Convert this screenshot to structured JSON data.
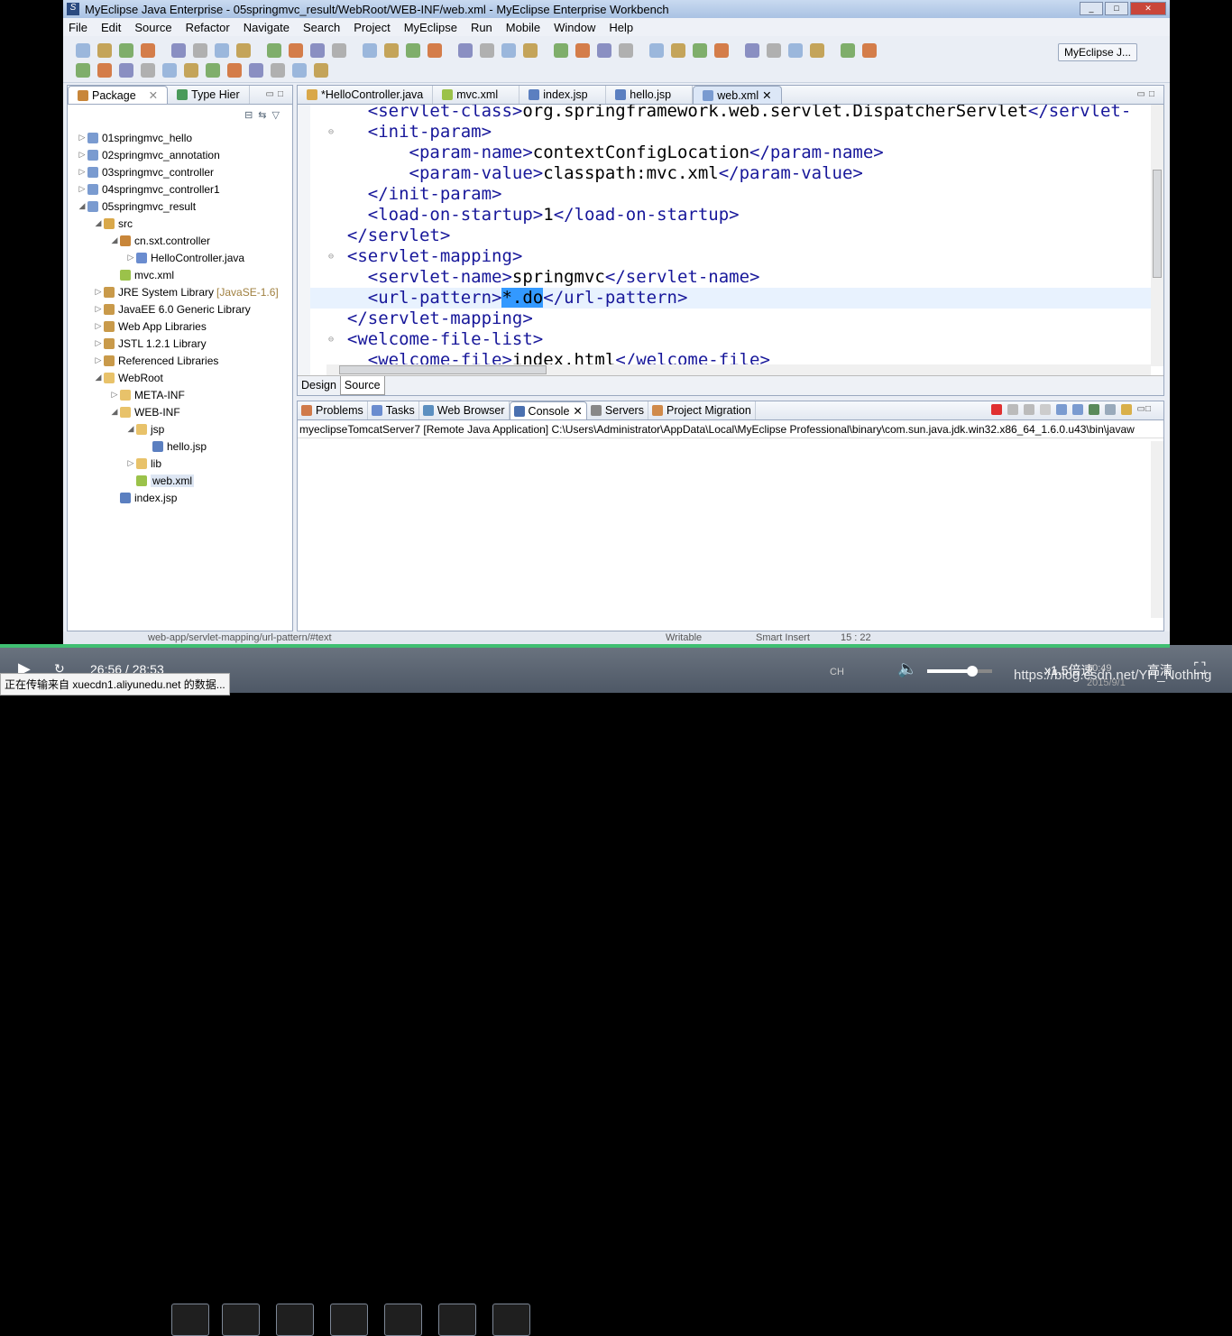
{
  "window": {
    "title": "MyEclipse Java Enterprise - 05springmvc_result/WebRoot/WEB-INF/web.xml - MyEclipse Enterprise Workbench"
  },
  "menu": [
    "File",
    "Edit",
    "Source",
    "Refactor",
    "Navigate",
    "Search",
    "Project",
    "MyEclipse",
    "Run",
    "Mobile",
    "Window",
    "Help"
  ],
  "perspective": "MyEclipse J...",
  "left_panel": {
    "tabs": [
      "Package",
      "Type Hier"
    ],
    "tree": [
      {
        "label": "01springmvc_hello",
        "level": 0,
        "arrow": "▷",
        "icon": "project"
      },
      {
        "label": "02springmvc_annotation",
        "level": 0,
        "arrow": "▷",
        "icon": "project"
      },
      {
        "label": "03springmvc_controller",
        "level": 0,
        "arrow": "▷",
        "icon": "project"
      },
      {
        "label": "04springmvc_controller1",
        "level": 0,
        "arrow": "▷",
        "icon": "project"
      },
      {
        "label": "05springmvc_result",
        "level": 0,
        "arrow": "◢",
        "icon": "project"
      },
      {
        "label": "src",
        "level": 1,
        "arrow": "◢",
        "icon": "src"
      },
      {
        "label": "cn.sxt.controller",
        "level": 2,
        "arrow": "◢",
        "icon": "package"
      },
      {
        "label": "HelloController.java",
        "level": 3,
        "arrow": "▷",
        "icon": "java"
      },
      {
        "label": "mvc.xml",
        "level": 2,
        "arrow": "",
        "icon": "xml"
      },
      {
        "label": "JRE System Library",
        "suffix": "[JavaSE-1.6]",
        "level": 1,
        "arrow": "▷",
        "icon": "library"
      },
      {
        "label": "JavaEE 6.0 Generic Library",
        "level": 1,
        "arrow": "▷",
        "icon": "library"
      },
      {
        "label": "Web App Libraries",
        "level": 1,
        "arrow": "▷",
        "icon": "library"
      },
      {
        "label": "JSTL 1.2.1 Library",
        "level": 1,
        "arrow": "▷",
        "icon": "library"
      },
      {
        "label": "Referenced Libraries",
        "level": 1,
        "arrow": "▷",
        "icon": "library"
      },
      {
        "label": "WebRoot",
        "level": 1,
        "arrow": "◢",
        "icon": "folder"
      },
      {
        "label": "META-INF",
        "level": 2,
        "arrow": "▷",
        "icon": "folder"
      },
      {
        "label": "WEB-INF",
        "level": 2,
        "arrow": "◢",
        "icon": "folder"
      },
      {
        "label": "jsp",
        "level": 3,
        "arrow": "◢",
        "icon": "folder"
      },
      {
        "label": "hello.jsp",
        "level": 4,
        "arrow": "",
        "icon": "jsp"
      },
      {
        "label": "lib",
        "level": 3,
        "arrow": "▷",
        "icon": "folder"
      },
      {
        "label": "web.xml",
        "level": 3,
        "arrow": "",
        "icon": "xml",
        "selected": true
      },
      {
        "label": "index.jsp",
        "level": 2,
        "arrow": "",
        "icon": "jsp"
      }
    ]
  },
  "editor": {
    "tabs": [
      "*HelloController.java",
      "mvc.xml",
      "index.jsp",
      "hello.jsp",
      "web.xml"
    ],
    "active_tab": 4,
    "lines": [
      {
        "indent": 2,
        "tag": "<servlet-class>",
        "text": "org.springframework.web.servlet.DispatcherServlet",
        "close": "</servlet-"
      },
      {
        "indent": 2,
        "tag": "<init-param>",
        "fold": true
      },
      {
        "indent": 4,
        "tag": "<param-name>",
        "text": "contextConfigLocation",
        "close": "</param-name>"
      },
      {
        "indent": 4,
        "tag": "<param-value>",
        "text": "classpath:mvc.xml",
        "close": "</param-value>"
      },
      {
        "indent": 2,
        "tag": "</init-param>"
      },
      {
        "indent": 2,
        "tag": "<load-on-startup>",
        "text": "1",
        "close": "</load-on-startup>"
      },
      {
        "indent": 1,
        "tag": "</servlet>"
      },
      {
        "indent": 1,
        "tag": "<servlet-mapping>",
        "fold": true
      },
      {
        "indent": 2,
        "tag": "<servlet-name>",
        "text": "springmvc",
        "close": "</servlet-name>"
      },
      {
        "indent": 2,
        "tag": "<url-pattern>",
        "text": "*.do",
        "close": "</url-pattern>",
        "current": true,
        "selected": true
      },
      {
        "indent": 1,
        "tag": "</servlet-mapping>"
      },
      {
        "indent": 1,
        "tag": "<welcome-file-list>",
        "fold": true
      },
      {
        "indent": 2,
        "tag": "<welcome-file>",
        "text": "index.html",
        "close": "</welcome-file>"
      }
    ],
    "bottom_tabs": [
      "Design",
      "Source"
    ],
    "active_bottom": 1
  },
  "console": {
    "tabs": [
      "Problems",
      "Tasks",
      "Web Browser",
      "Console",
      "Servers",
      "Project Migration"
    ],
    "active": 3,
    "header": "myeclipseTomcatServer7 [Remote Java Application] C:\\Users\\Administrator\\AppData\\Local\\MyEclipse Professional\\binary\\com.sun.java.jdk.win32.x86_64_1.6.0.u43\\bin\\javaw"
  },
  "status": {
    "path": "web-app/servlet-mapping/url-pattern/#text",
    "mode": "Writable",
    "insert": "Smart Insert",
    "position": "15 : 22"
  },
  "video": {
    "time": "26:56 / 28:53",
    "speed": "x1.5倍速",
    "quality": "高清",
    "watermark": "https://blog.csdn.net/YH_Nothing",
    "progress": 0.944,
    "volume": 0.7,
    "clock": "10:49",
    "date": "2015/9/1",
    "ime": "CH"
  },
  "tooltip": "正在传输来自 xuecdn1.aliyunedu.net 的数据..."
}
